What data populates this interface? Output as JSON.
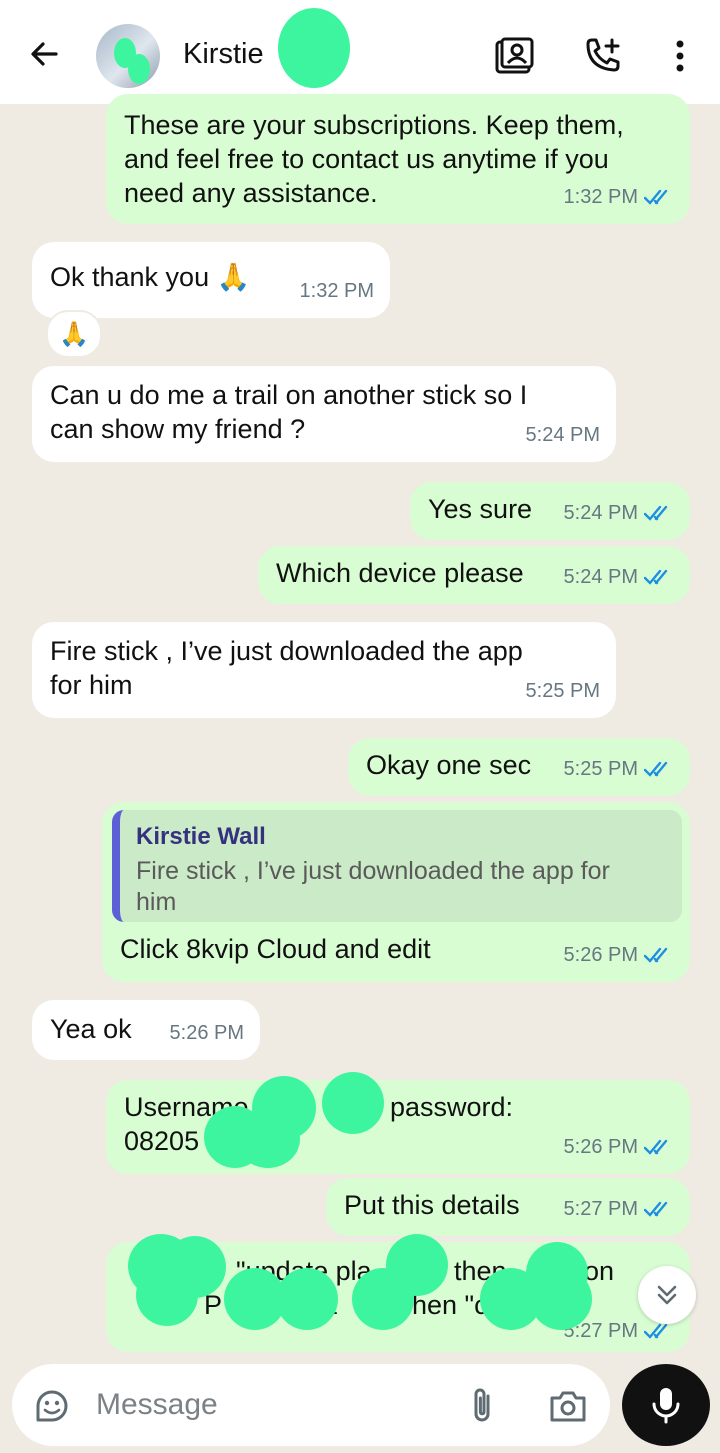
{
  "header": {
    "contact_name": "Kirstie"
  },
  "messages": [
    {
      "dir": "out",
      "lines": [
        "These are your subscriptions. Keep them,",
        "and feel free to contact us anytime if you",
        "need any assistance."
      ],
      "time": "1:32 PM"
    },
    {
      "dir": "in",
      "lines": [
        "Ok thank you 🙏"
      ],
      "time": "1:32 PM",
      "reaction": "🙏"
    },
    {
      "dir": "in",
      "lines": [
        "Can u do me a trail on another stick so I",
        "can show my friend ?"
      ],
      "time": "5:24 PM"
    },
    {
      "dir": "out",
      "lines": [
        "Yes sure"
      ],
      "time": "5:24 PM"
    },
    {
      "dir": "out",
      "lines": [
        "Which device please"
      ],
      "time": "5:24 PM"
    },
    {
      "dir": "in",
      "lines": [
        "Fire stick , I’ve just downloaded the app",
        "for him"
      ],
      "time": "5:25 PM"
    },
    {
      "dir": "out",
      "lines": [
        "Okay one sec"
      ],
      "time": "5:25 PM"
    },
    {
      "dir": "out",
      "quote": {
        "name": "Kirstie Wall",
        "text": "Fire stick , I’ve just downloaded the app for him"
      },
      "lines": [
        "Click 8kvip Cloud and edit"
      ],
      "time": "5:26 PM"
    },
    {
      "dir": "in",
      "lines": [
        "Yea ok"
      ],
      "time": "5:26 PM"
    },
    {
      "dir": "out",
      "lines": [
        "Username",
        "password:",
        "08205"
      ],
      "time": "5:26 PM"
    },
    {
      "dir": "out",
      "lines": [
        "Put this details"
      ],
      "time": "5:27 PM"
    },
    {
      "dir": "out",
      "lines": [
        "\"update pla",
        "then",
        "on",
        "P",
        "a",
        "hen \"c"
      ],
      "time": "5:27 PM"
    }
  ],
  "composer": {
    "placeholder": "Message"
  }
}
